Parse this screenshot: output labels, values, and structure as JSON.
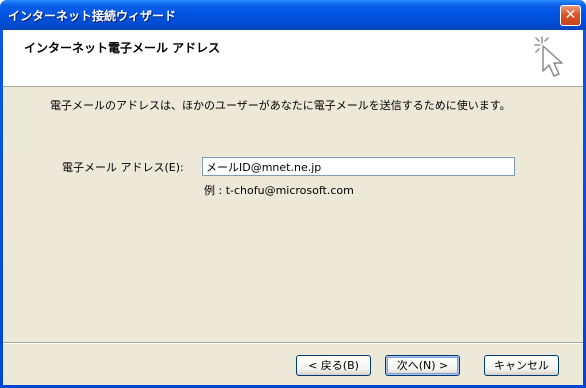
{
  "window": {
    "title": "インターネット接続ウィザード",
    "close_glyph": "✕"
  },
  "header": {
    "title": "インターネット電子メール アドレス",
    "icon": "wizard-sparkle-cursor-icon"
  },
  "content": {
    "description": "電子メールのアドレスは、ほかのユーザーがあなたに電子メールを送信するために使います。",
    "email_label": "電子メール アドレス(E):",
    "email_value": "メールID@mnet.ne.jp",
    "example": "例 : t-chofu@microsoft.com"
  },
  "buttons": {
    "back": "< 戻る(B)",
    "next": "次へ(N) >",
    "cancel": "キャンセル"
  },
  "colors": {
    "title_bar": "#0054e3",
    "dialog_face": "#ece9d8",
    "close_button": "#d9552b"
  }
}
